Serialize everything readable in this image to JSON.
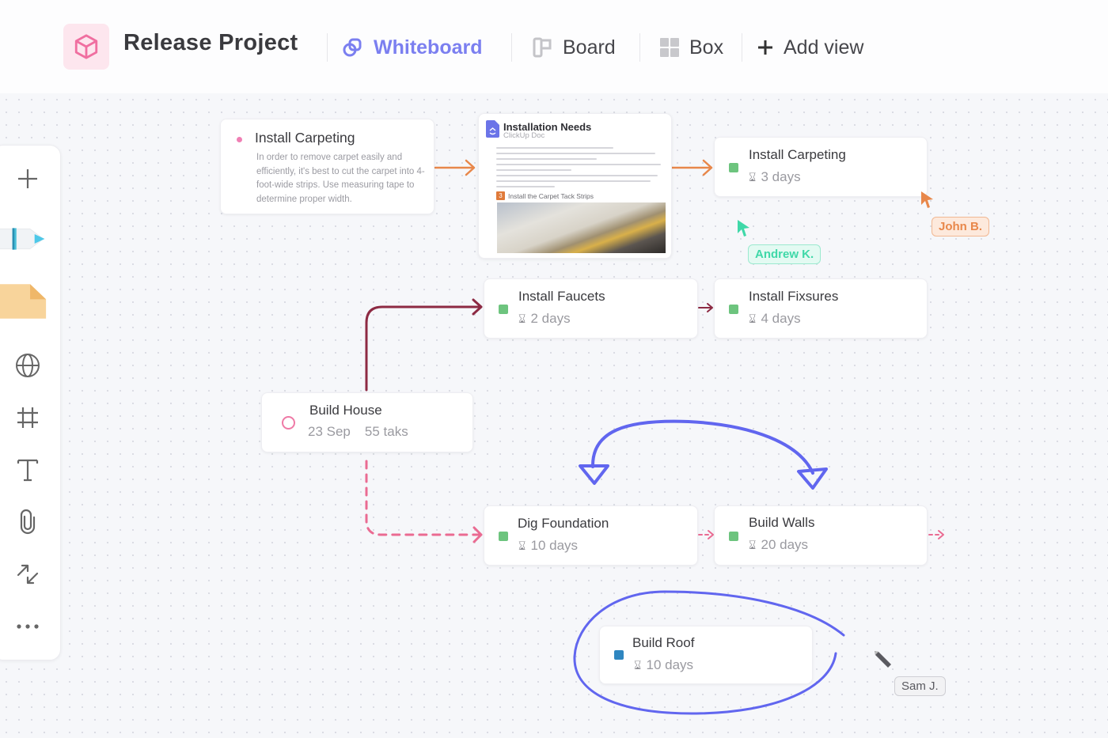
{
  "header": {
    "project_icon": "cube-icon",
    "title": "Release Project",
    "tabs": [
      {
        "label": "Whiteboard",
        "icon": "whiteboard-icon",
        "active": true
      },
      {
        "label": "Board",
        "icon": "board-icon",
        "active": false
      },
      {
        "label": "Box",
        "icon": "box-grid-icon",
        "active": false
      },
      {
        "label": "Add view",
        "icon": "plus-icon",
        "active": false
      }
    ],
    "accent_color": "#7b7ff0"
  },
  "toolbar": {
    "tools": [
      {
        "name": "add",
        "icon": "plus-icon"
      },
      {
        "name": "pen",
        "icon": "pen-icon"
      },
      {
        "name": "sticky-note",
        "icon": "sticky-note-icon"
      },
      {
        "name": "web-embed",
        "icon": "globe-icon"
      },
      {
        "name": "frame",
        "icon": "frame-icon"
      },
      {
        "name": "text",
        "icon": "text-icon"
      },
      {
        "name": "attachment",
        "icon": "paperclip-icon"
      },
      {
        "name": "connector",
        "icon": "connector-arrows-icon"
      },
      {
        "name": "more",
        "icon": "more-dots-icon"
      }
    ]
  },
  "cards": {
    "note": {
      "title": "Install Carpeting",
      "description": "In order to remove carpet easily and efficiently, it's best to cut the carpet into 4-foot-wide strips. Use measuring tape to determine proper width.",
      "dot_color": "#f07fb4"
    },
    "doc": {
      "title": "Installation Needs",
      "subtitle": "ClickUp Doc",
      "step_number": "3",
      "step_title": "Install the Carpet Tack Strips"
    },
    "install_carpeting": {
      "title": "Install Carpeting",
      "duration": "3 days",
      "status_color": "#6dc47e"
    },
    "install_faucets": {
      "title": "Install Faucets",
      "duration": "2 days",
      "status_color": "#6dc47e"
    },
    "install_fixsures": {
      "title": "Install Fixsures",
      "duration": "4 days",
      "status_color": "#6dc47e"
    },
    "build_house": {
      "title": "Build House",
      "date": "23 Sep",
      "tasks": "55 taks",
      "ring_color": "#ef7aa6"
    },
    "dig_foundation": {
      "title": "Dig Foundation",
      "duration": "10 days",
      "status_color": "#6dc47e"
    },
    "build_walls": {
      "title": "Build Walls",
      "duration": "20 days",
      "status_color": "#6dc47e"
    },
    "build_roof": {
      "title": "Build Roof",
      "duration": "10 days",
      "status_color": "#2f86c0"
    }
  },
  "collaborators": [
    {
      "name": "John B.",
      "color": "#e8874a"
    },
    {
      "name": "Andrew K.",
      "color": "#3fd8a8"
    },
    {
      "name": "Sam J.",
      "color": "#5a5a60"
    }
  ],
  "connector_colors": {
    "orange": "#e8874a",
    "maroon": "#8d2a43",
    "pink_dashed": "#ea6b92",
    "drawing_blue": "#6166ef"
  }
}
